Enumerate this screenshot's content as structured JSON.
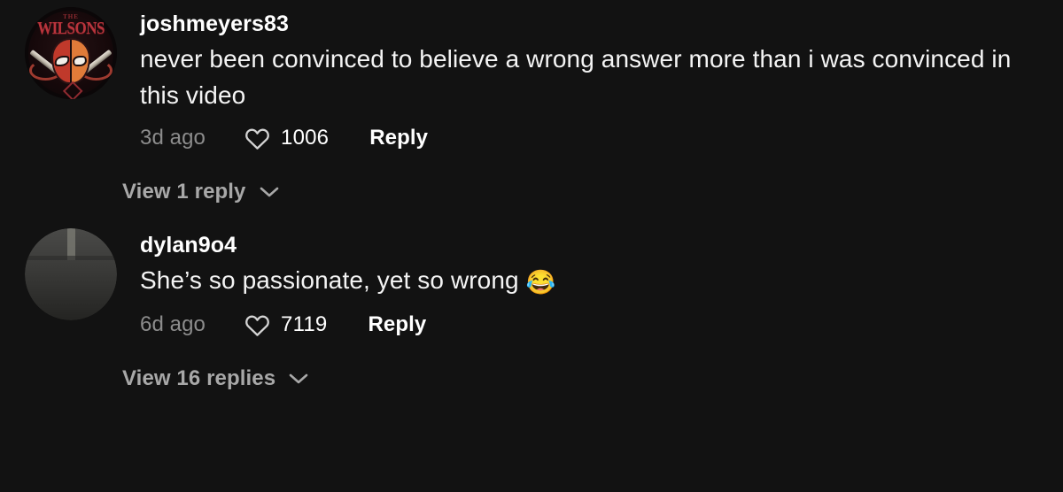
{
  "panel": {
    "background_color": "#121212",
    "text_color": "#f4f4f4",
    "muted_color": "#8c8c8c",
    "link_color": "#a8a8a8"
  },
  "comments": [
    {
      "username": "joshmeyers83",
      "text": "never been convinced to believe a wrong answer more than i was convinced in this video",
      "emoji": "",
      "time": "3d ago",
      "like_count": "1006",
      "reply_label": "Reply",
      "view_replies_label": "View 1 reply",
      "heart_icon": "heart-outline-icon",
      "chevron_icon": "chevron-down-icon",
      "avatar_alt": "the-wilsons-logo-avatar"
    },
    {
      "username": "dylan9o4",
      "text": "She’s so passionate, yet so wrong ",
      "emoji": "😂",
      "time": "6d ago",
      "like_count": "7119",
      "reply_label": "Reply",
      "view_replies_label": "View 16 replies",
      "heart_icon": "heart-outline-icon",
      "chevron_icon": "chevron-down-icon",
      "avatar_alt": "three-friends-photo-avatar"
    }
  ],
  "avatar_logo": {
    "the_label": "THE",
    "wordmark": "WILSONS"
  }
}
